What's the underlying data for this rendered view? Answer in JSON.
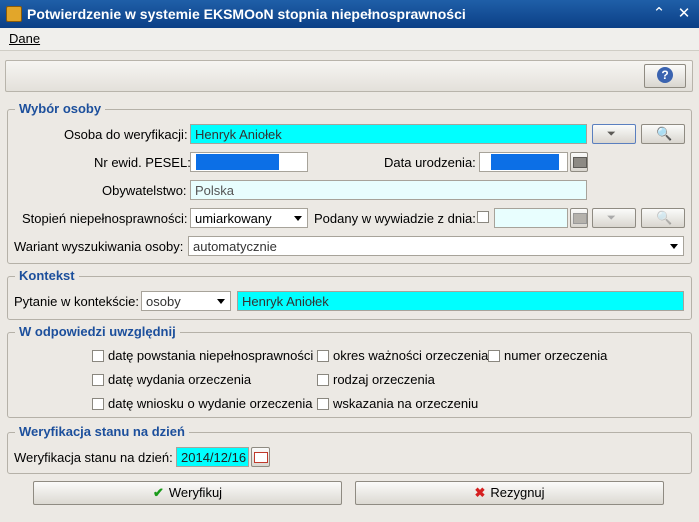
{
  "window": {
    "title": "Potwierdzenie w systemie EKSMOoN stopnia niepełnosprawności"
  },
  "menu": {
    "dane": "Dane"
  },
  "wybor": {
    "legend": "Wybór osoby",
    "osoba_label": "Osoba do weryfikacji:",
    "osoba_value": "Henryk Aniołek",
    "pesel_label": "Nr ewid. PESEL:",
    "data_ur_label": "Data urodzenia:",
    "obyw_label": "Obywatelstwo:",
    "obyw_value": "Polska",
    "stopien_label": "Stopień niepełnosprawności:",
    "stopien_value": "umiarkowany",
    "podany_label": "Podany w wywiadzie z dnia:",
    "wariant_label": "Wariant wyszukiwania osoby:",
    "wariant_value": "automatycznie"
  },
  "kontekst": {
    "legend": "Kontekst",
    "pytanie_label": "Pytanie w kontekście:",
    "pytanie_value": "osoby",
    "osoba_value": "Henryk Aniołek"
  },
  "odpowiedz": {
    "legend": "W odpowiedzi uwzględnij",
    "options": [
      "datę powstania niepełnosprawności",
      "okres ważności orzeczenia",
      "numer orzeczenia",
      "datę wydania orzeczenia",
      "rodzaj orzeczenia",
      "datę wniosku o wydanie orzeczenia",
      "wskazania na orzeczeniu"
    ]
  },
  "weryfikacja": {
    "legend": "Weryfikacja stanu na dzień",
    "label": "Weryfikacja stanu na dzień:",
    "value": "2014/12/16"
  },
  "buttons": {
    "weryfikuj": "Weryfikuj",
    "rezygnuj": "Rezygnuj"
  }
}
